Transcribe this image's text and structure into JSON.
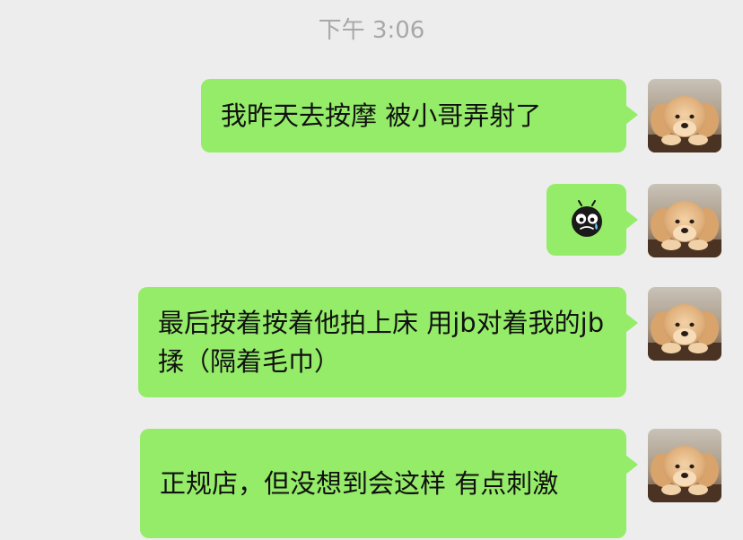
{
  "chat": {
    "timestamp": "下午 3:06",
    "messages": [
      {
        "text": "我昨天去按摩 被小哥弄射了"
      },
      {
        "emoji": "crying-bug-sticker-icon"
      },
      {
        "text": "最后按着按着他拍上床 用jb对着我的jb揉（隔着毛巾）"
      },
      {
        "text": "正规店，但没想到会这样 有点刺激"
      }
    ]
  },
  "colors": {
    "background": "#ededed",
    "bubble": "#95ec69",
    "timestamp": "#a8a8a8",
    "text": "#111111"
  },
  "avatar": {
    "icon": "puppy-avatar-icon"
  }
}
